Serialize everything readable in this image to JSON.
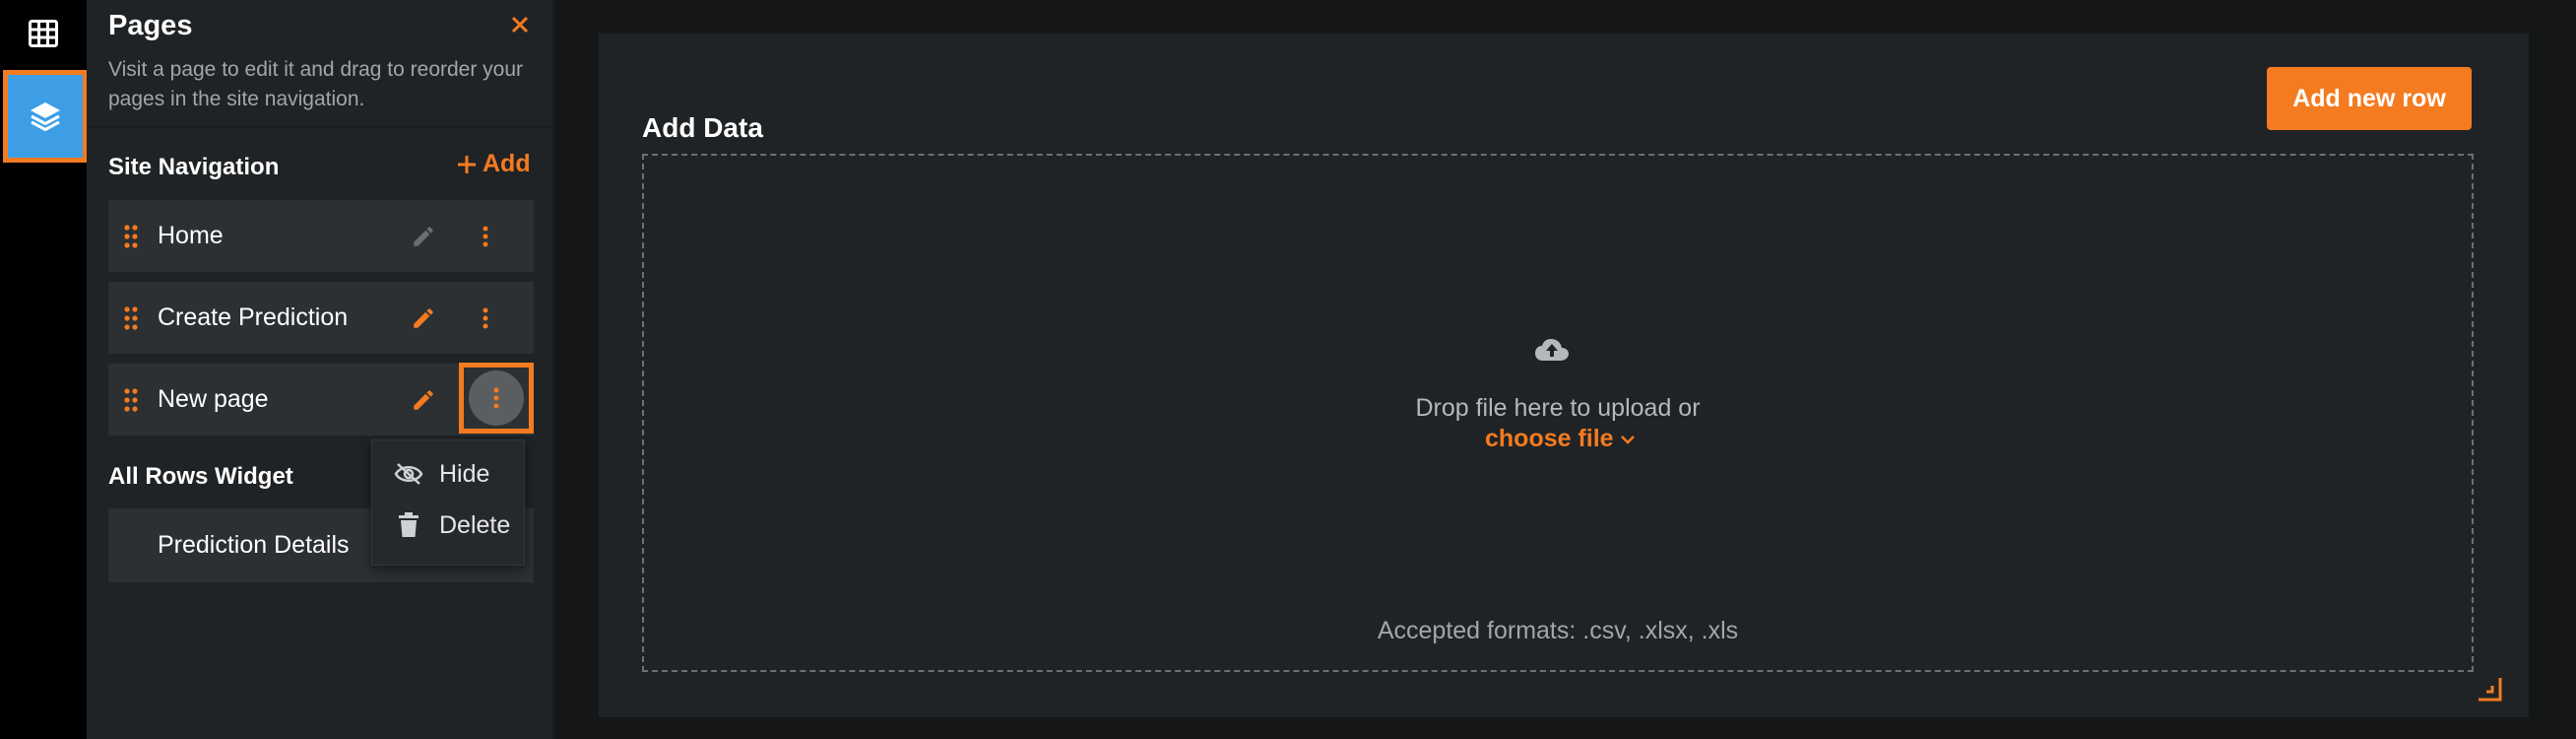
{
  "rail": {
    "items": [
      {
        "icon": "table-grid-icon",
        "active": false
      },
      {
        "icon": "layers-icon",
        "active": true
      }
    ]
  },
  "pages_panel": {
    "title": "Pages",
    "description": "Visit a page to edit it and drag to reorder your pages in the site navigation.",
    "close_icon": "close-icon",
    "site_navigation": {
      "title": "Site Navigation",
      "add_label": "Add",
      "items": [
        {
          "label": "Home",
          "edit_enabled": false
        },
        {
          "label": "Create Prediction",
          "edit_enabled": true
        },
        {
          "label": "New page",
          "edit_enabled": true
        }
      ]
    },
    "all_rows_widget": {
      "title": "All Rows Widget",
      "items": [
        {
          "label": "Prediction Details"
        }
      ]
    }
  },
  "context_menu": {
    "items": [
      {
        "label": "Hide",
        "icon": "eye-off-icon"
      },
      {
        "label": "Delete",
        "icon": "trash-icon"
      }
    ]
  },
  "main": {
    "card_title": "Add Data",
    "add_row_label": "Add new row",
    "dropzone": {
      "text": "Drop file here to upload or",
      "choose_label": "choose file",
      "formats": "Accepted formats: .csv, .xlsx, .xls"
    }
  },
  "colors": {
    "accent": "#f47b20",
    "rail_active": "#3d9ee6",
    "panel_bg": "#202325",
    "item_bg": "#2c3033",
    "page_bg": "#141618"
  }
}
